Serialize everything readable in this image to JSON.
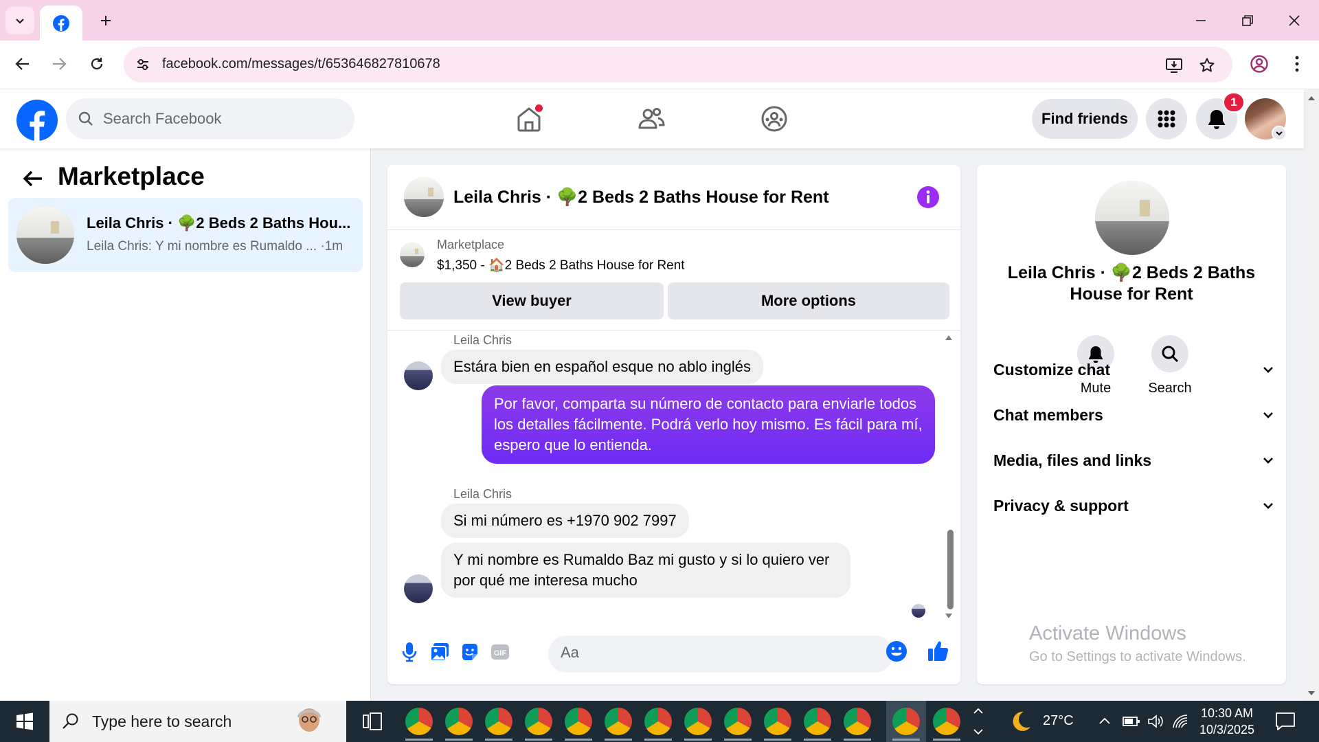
{
  "browser": {
    "url": "facebook.com/messages/t/653646827810678",
    "new_tab": "+"
  },
  "fb": {
    "search_placeholder": "Search Facebook",
    "find_friends": "Find friends",
    "notif_count": "1"
  },
  "left": {
    "title": "Marketplace",
    "conv_name": "Leila Chris · 🌳2 Beds 2 Baths Hou...",
    "conv_preview": "Leila Chris: Y mi nombre es Rumaldo ... ·1m"
  },
  "chat": {
    "title": "Leila Chris · 🌳2 Beds 2 Baths House for Rent",
    "listing_category": "Marketplace",
    "listing_title": "$1,350 - 🏠2 Beds 2 Baths House for Rent",
    "view_buyer": "View buyer",
    "more_options": "More options",
    "messages": [
      {
        "sender": "Leila Chris",
        "text": "Estára bien en español esque no ablo inglés"
      },
      {
        "text": "Por favor, comparta su número de contacto para enviarle todos los detalles fácilmente. Podrá verlo hoy mismo. Es fácil para mí, espero que lo entienda."
      },
      {
        "sender": "Leila Chris",
        "text": "Si mi número es +1970 902 7997"
      },
      {
        "text": "Y mi nombre es Rumaldo Baz mi gusto y si lo quiero ver por qué me interesa mucho"
      }
    ],
    "composer_placeholder": "Aa"
  },
  "right": {
    "title": "Leila Chris · 🌳2 Beds 2 Baths House for Rent",
    "mute": "Mute",
    "search": "Search",
    "sections": [
      "Customize chat",
      "Chat members",
      "Media, files and links",
      "Privacy & support"
    ],
    "activate_title": "Activate Windows",
    "activate_sub": "Go to Settings to activate Windows."
  },
  "taskbar": {
    "search_placeholder": "Type here to search",
    "temperature": "27°C",
    "time": "10:30 AM",
    "date": "10/3/2025"
  },
  "colors": {
    "fb_blue": "#0866ff",
    "messenger_purple": "#7b33f0",
    "badge_red": "#e41e3f"
  }
}
